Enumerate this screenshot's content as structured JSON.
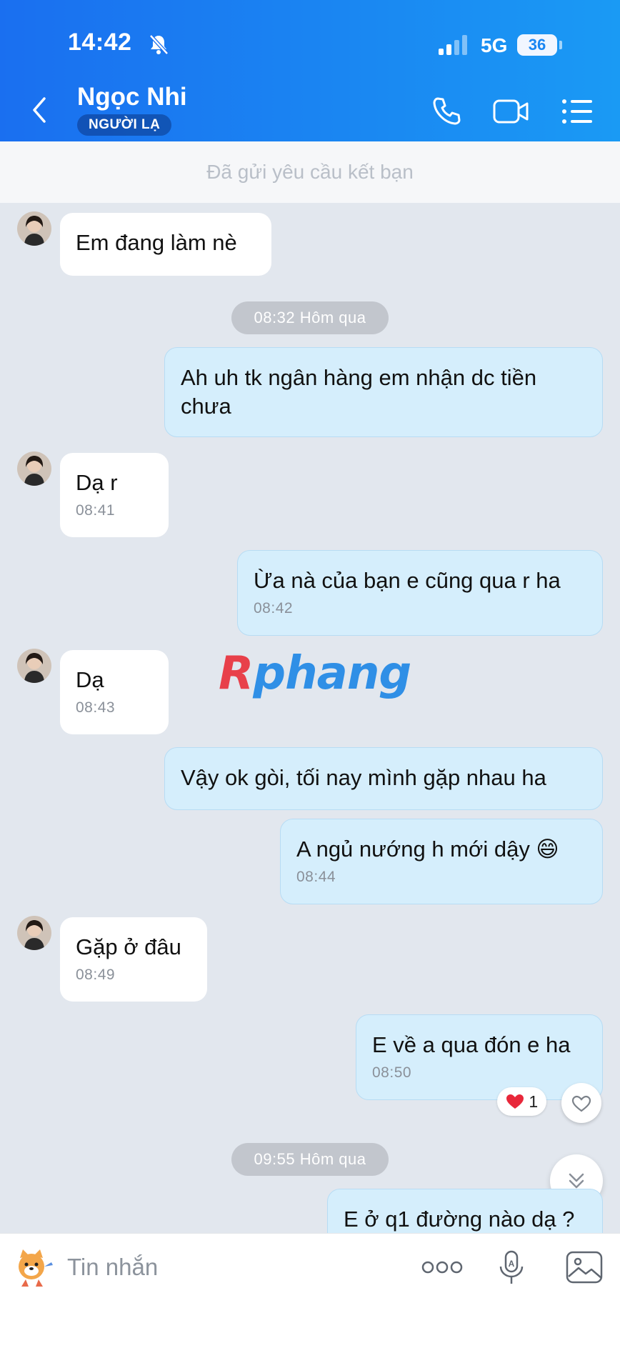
{
  "status_bar": {
    "time": "14:42",
    "network": "5G",
    "battery": "36"
  },
  "header": {
    "contact_name": "Ngọc Nhi",
    "badge": "NGƯỜI LẠ"
  },
  "banner": {
    "text": "Đã gửi yêu cầu kết bạn"
  },
  "messages": [
    {
      "side": "in",
      "text": "Em đang làm nè",
      "time": ""
    },
    {
      "side": "divider",
      "text": "08:32 Hôm qua"
    },
    {
      "side": "out",
      "text": "Ah uh tk ngân hàng em nhận dc tiền chưa",
      "time": ""
    },
    {
      "side": "in",
      "text": "Dạ r",
      "time": "08:41"
    },
    {
      "side": "out",
      "text": "Ừa nà của bạn e cũng qua r ha",
      "time": "08:42"
    },
    {
      "side": "in",
      "text": "Dạ",
      "time": "08:43"
    },
    {
      "side": "out",
      "text": "Vậy ok gòi, tối nay mình gặp nhau ha",
      "time": ""
    },
    {
      "side": "out",
      "text": "A ngủ nướng h mới dậy 😄",
      "time": "08:44"
    },
    {
      "side": "in",
      "text": "Gặp ở đâu",
      "time": "08:49"
    },
    {
      "side": "out",
      "text": "E về a qua đón e ha",
      "time": "08:50",
      "reaction_count": "1"
    },
    {
      "side": "divider",
      "text": "09:55 Hôm qua"
    },
    {
      "side": "out",
      "text": "E ở q1 đường nào dạ ?",
      "time": ""
    }
  ],
  "watermark": {
    "text": "Rphang"
  },
  "input_bar": {
    "placeholder": "Tin nhắn"
  },
  "colors": {
    "header": "#1a86f2",
    "incoming": "#ffffff",
    "outgoing": "#d5eefc",
    "background": "#e2e7ee"
  },
  "icons": [
    "bell-mute-icon",
    "signal-icon",
    "back-icon",
    "phone-icon",
    "video-call-icon",
    "menu-icon",
    "heart-icon",
    "chevron-down-icon",
    "sticker-icon",
    "more-icon",
    "mic-icon",
    "image-icon"
  ]
}
